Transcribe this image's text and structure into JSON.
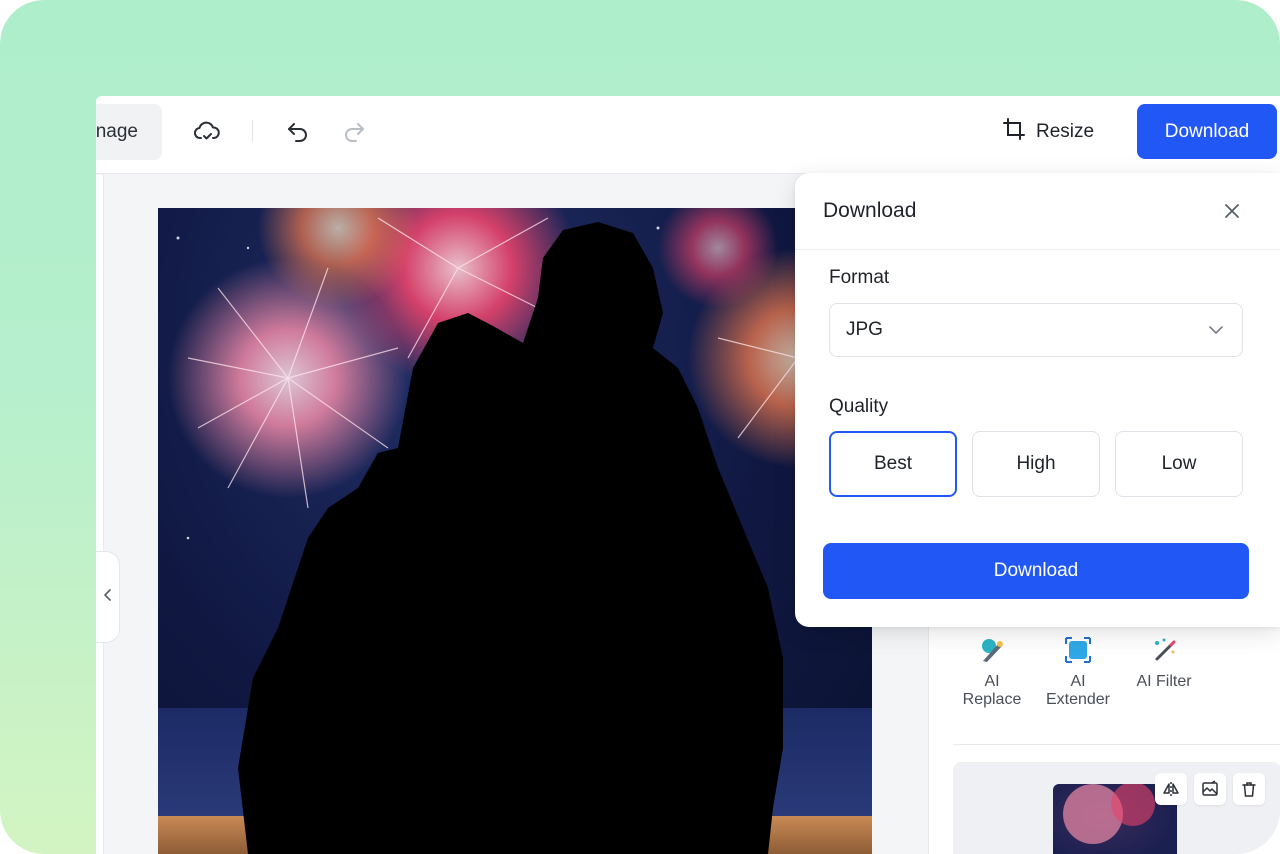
{
  "toolbar": {
    "image_button_label": "nage",
    "resize_label": "Resize",
    "download_label": "Download",
    "icons": {
      "cloud": "cloud-sync-icon",
      "undo": "undo-icon",
      "redo": "redo-icon",
      "crop": "crop-icon"
    }
  },
  "download_popover": {
    "title": "Download",
    "format_label": "Format",
    "format_value": "JPG",
    "quality_label": "Quality",
    "quality_options": [
      "Best",
      "High",
      "Low"
    ],
    "quality_selected": "Best",
    "download_button": "Download"
  },
  "right_panel": {
    "tools": [
      {
        "label": "AI Replace",
        "icon": "ai-replace-icon"
      },
      {
        "label": "AI Extender",
        "icon": "ai-extender-icon"
      },
      {
        "label": "AI Filter",
        "icon": "ai-filter-icon"
      }
    ],
    "layer_actions": [
      "flip-icon",
      "replace-image-icon",
      "trash-icon"
    ]
  },
  "colors": {
    "accent": "#2158f5",
    "frame_top": "#aeeecb",
    "frame_bottom": "#d3f4c2"
  }
}
